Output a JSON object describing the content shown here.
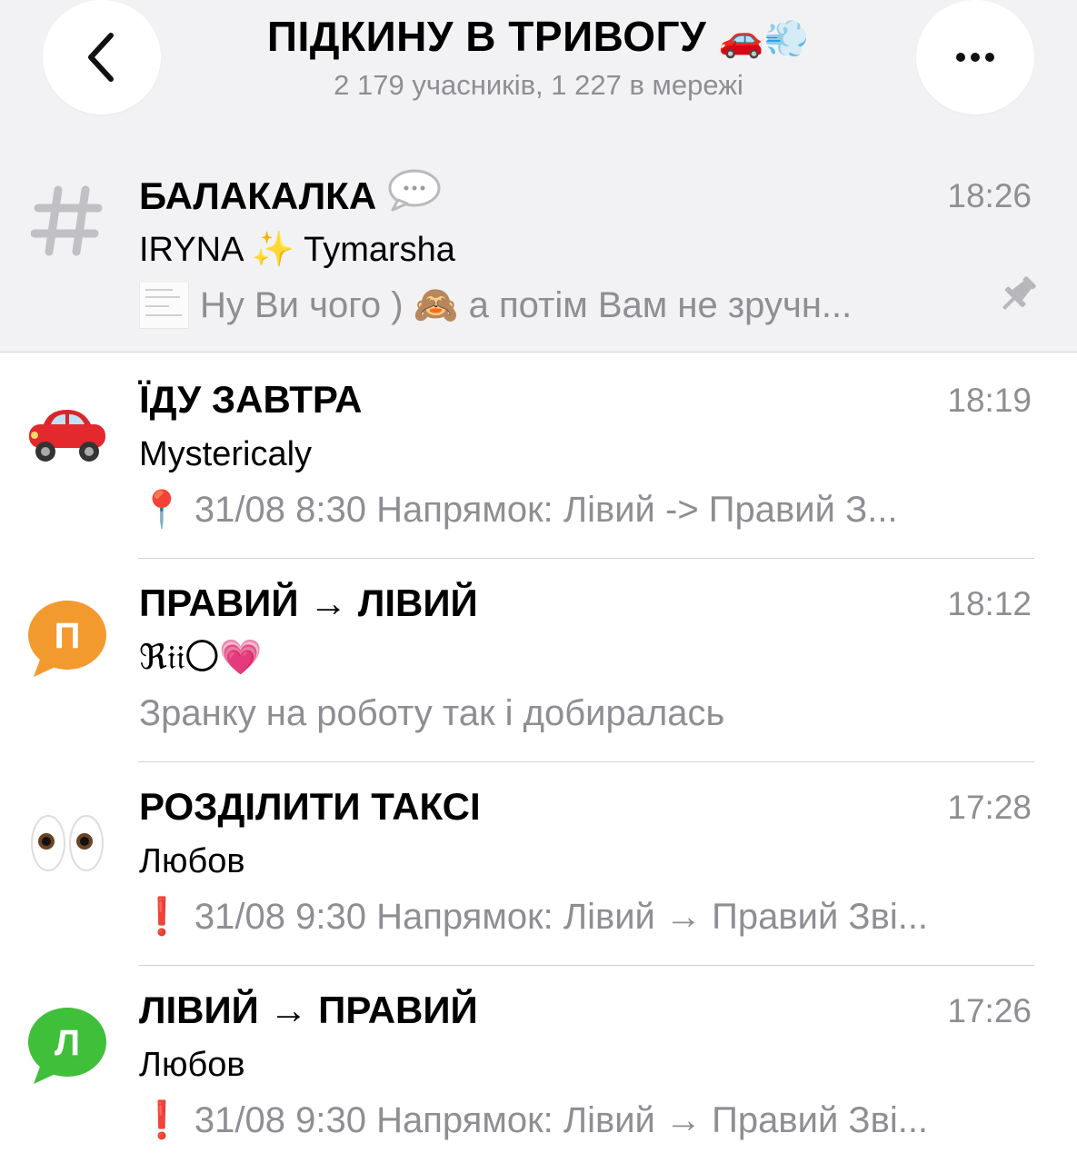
{
  "header": {
    "title": "ПІДКИНУ В ТРИВОГУ",
    "title_emoji": "🚗💨",
    "subtitle": "2 179 учасників, 1 227 в мережі"
  },
  "chats": [
    {
      "name": "БАЛАКАЛКА",
      "name_emoji": "💬",
      "time": "18:26",
      "sender": "IRYNA ✨ Tymarsha",
      "preview": "Ну Ви чого ) 🙈 а потім Вам не зручн...",
      "pinned": true,
      "avatar_icon": "hash-icon"
    },
    {
      "name": "ЇДУ ЗАВТРА",
      "time": "18:19",
      "sender": "Mystericaly",
      "preview": "📍 31/08 8:30 Напрямок: Лівий -> Правий З...",
      "avatar_icon": "red-car-icon"
    },
    {
      "name": "ПРАВИЙ → ЛІВИЙ",
      "time": "18:12",
      "sender": "ℜ𝔦𝔦〇💗",
      "preview": "Зранку на роботу так і добиралась",
      "avatar_letter": "П",
      "avatar_color": "#f39a2e"
    },
    {
      "name": "РОЗДІЛИТИ ТАКСІ",
      "time": "17:28",
      "sender": "Любов",
      "preview": "❗ 31/08 9:30 Напрямок: Лівий → Правий Зві...",
      "avatar_icon": "eyes-icon"
    },
    {
      "name": "ЛІВИЙ → ПРАВИЙ",
      "time": "17:26",
      "sender": "Любов",
      "preview": "❗ 31/08 9:30 Напрямок: Лівий → Правий Зві...",
      "avatar_letter": "Л",
      "avatar_color": "#3fbf3a"
    }
  ]
}
